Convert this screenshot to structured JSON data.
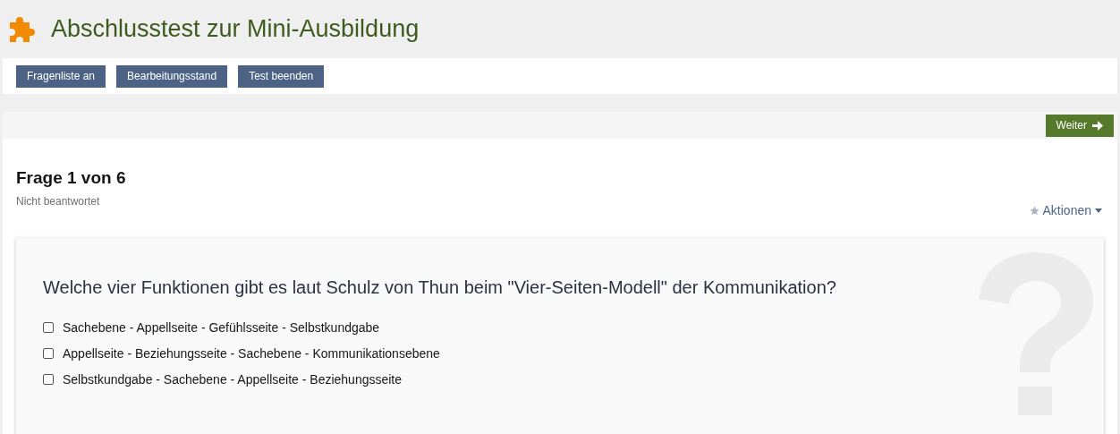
{
  "title": "Abschlusstest zur Mini-Ausbildung",
  "toolbar": [
    "Fragenliste an",
    "Bearbeitungsstand",
    "Test beenden"
  ],
  "next_button": "Weiter",
  "question_heading": "Frage 1 von 6",
  "status": "Nicht beantwortet",
  "actions": "Aktionen",
  "question": "Welche vier Funktionen gibt es laut Schulz von Thun beim \"Vier-Seiten-Modell\" der Kommunikation?",
  "answers": [
    {
      "label": "Sachebene - Appellseite - Gefühlsseite - Selbstkundgabe",
      "checked": false
    },
    {
      "label": "Appellseite - Beziehungsseite - Sachebene - Kommunikationsebene",
      "checked": false
    },
    {
      "label": "Selbstkundgabe - Sachebene - Appellseite - Beziehungsseite",
      "checked": false
    }
  ]
}
